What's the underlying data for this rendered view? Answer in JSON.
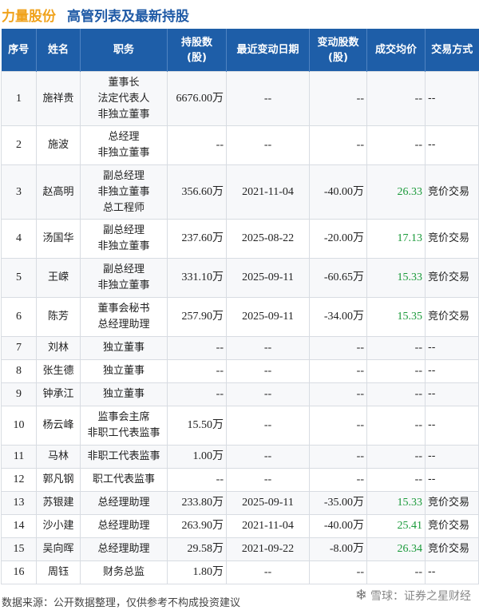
{
  "header": {
    "company": "力量股份",
    "title": "高管列表及最新持股"
  },
  "table": {
    "columns": [
      "序号",
      "姓名",
      "职务",
      "持股数\n(股)",
      "最近变动日期",
      "变动股数\n(股)",
      "成交均价",
      "交易方式"
    ],
    "rows": [
      {
        "no": "1",
        "name": "施祥贵",
        "role": [
          "董事长",
          "法定代表人",
          "非独立董事"
        ],
        "shares": "6676.00万",
        "date": "--",
        "change": "--",
        "price": "--",
        "method": "--",
        "price_pos": false
      },
      {
        "no": "2",
        "name": "施波",
        "role": [
          "总经理",
          "非独立董事"
        ],
        "shares": "--",
        "date": "--",
        "change": "--",
        "price": "--",
        "method": "--",
        "price_pos": false
      },
      {
        "no": "3",
        "name": "赵高明",
        "role": [
          "副总经理",
          "非独立董事",
          "总工程师"
        ],
        "shares": "356.60万",
        "date": "2021-11-04",
        "change": "-40.00万",
        "price": "26.33",
        "method": "竞价交易",
        "price_pos": true
      },
      {
        "no": "4",
        "name": "汤国华",
        "role": [
          "副总经理",
          "非独立董事"
        ],
        "shares": "237.60万",
        "date": "2025-08-22",
        "change": "-20.00万",
        "price": "17.13",
        "method": "竞价交易",
        "price_pos": true
      },
      {
        "no": "5",
        "name": "王嵘",
        "role": [
          "副总经理",
          "非独立董事"
        ],
        "shares": "331.10万",
        "date": "2025-09-11",
        "change": "-60.65万",
        "price": "15.33",
        "method": "竞价交易",
        "price_pos": true
      },
      {
        "no": "6",
        "name": "陈芳",
        "role": [
          "董事会秘书",
          "总经理助理"
        ],
        "shares": "257.90万",
        "date": "2025-09-11",
        "change": "-34.00万",
        "price": "15.35",
        "method": "竞价交易",
        "price_pos": true
      },
      {
        "no": "7",
        "name": "刘林",
        "role": [
          "独立董事"
        ],
        "shares": "--",
        "date": "--",
        "change": "--",
        "price": "--",
        "method": "--",
        "price_pos": false
      },
      {
        "no": "8",
        "name": "张生德",
        "role": [
          "独立董事"
        ],
        "shares": "--",
        "date": "--",
        "change": "--",
        "price": "--",
        "method": "--",
        "price_pos": false
      },
      {
        "no": "9",
        "name": "钟承江",
        "role": [
          "独立董事"
        ],
        "shares": "--",
        "date": "--",
        "change": "--",
        "price": "--",
        "method": "--",
        "price_pos": false
      },
      {
        "no": "10",
        "name": "杨云峰",
        "role": [
          "监事会主席",
          "非职工代表监事"
        ],
        "shares": "15.50万",
        "date": "--",
        "change": "--",
        "price": "--",
        "method": "--",
        "price_pos": false
      },
      {
        "no": "11",
        "name": "马林",
        "role": [
          "非职工代表监事"
        ],
        "shares": "1.00万",
        "date": "--",
        "change": "--",
        "price": "--",
        "method": "--",
        "price_pos": false
      },
      {
        "no": "12",
        "name": "郭凡钢",
        "role": [
          "职工代表监事"
        ],
        "shares": "--",
        "date": "--",
        "change": "--",
        "price": "--",
        "method": "--",
        "price_pos": false
      },
      {
        "no": "13",
        "name": "苏银建",
        "role": [
          "总经理助理"
        ],
        "shares": "233.80万",
        "date": "2025-09-11",
        "change": "-35.00万",
        "price": "15.33",
        "method": "竞价交易",
        "price_pos": true
      },
      {
        "no": "14",
        "name": "沙小建",
        "role": [
          "总经理助理"
        ],
        "shares": "263.90万",
        "date": "2021-11-04",
        "change": "-40.00万",
        "price": "25.41",
        "method": "竞价交易",
        "price_pos": true
      },
      {
        "no": "15",
        "name": "吴向晖",
        "role": [
          "总经理助理"
        ],
        "shares": "29.58万",
        "date": "2021-09-22",
        "change": "-8.00万",
        "price": "26.34",
        "method": "竞价交易",
        "price_pos": true
      },
      {
        "no": "16",
        "name": "周钰",
        "role": [
          "财务总监"
        ],
        "shares": "1.80万",
        "date": "--",
        "change": "--",
        "price": "--",
        "method": "--",
        "price_pos": false
      }
    ]
  },
  "footer": {
    "source": "数据来源：公开数据整理，仅供参考不构成投资建议"
  },
  "brand": {
    "text": "雪球：证券之星财经",
    "icon": "snowball-icon"
  },
  "colors": {
    "header_bg": "#1e5ea8",
    "company": "#f0a21b",
    "title": "#1f5aa6",
    "price_positive": "#1a9a3a"
  }
}
